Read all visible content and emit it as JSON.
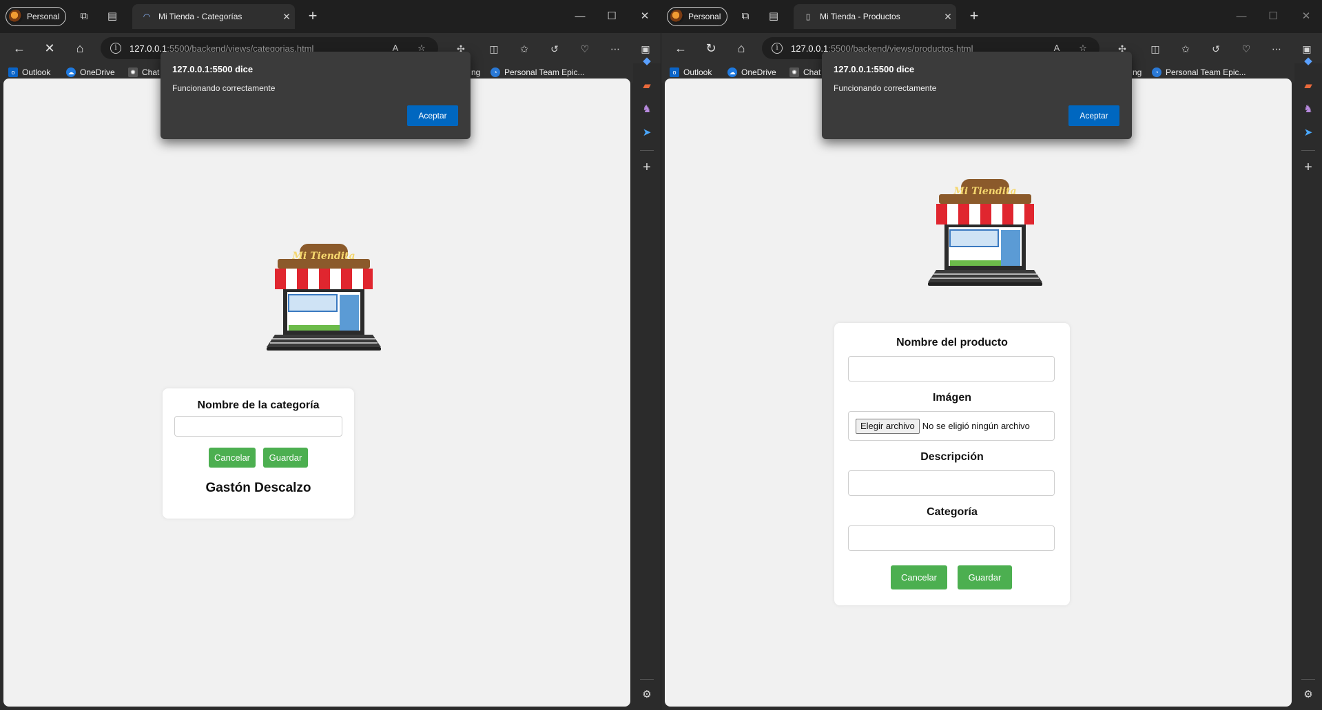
{
  "left": {
    "profile": "Personal",
    "tab_title": "Mi Tienda - Categorías",
    "url_host": "127.0.0.1",
    "url_path": ":5500/backend/views/categorias.html",
    "bookmarks": [
      "Outlook",
      "OneDrive",
      "Chat",
      "ng",
      "Personal Team Epic..."
    ],
    "dialog": {
      "title": "127.0.0.1:5500 dice",
      "message": "Funcionando correctamente",
      "button": "Aceptar"
    },
    "form": {
      "label": "Nombre de la categoría",
      "input_value": "",
      "cancel": "Cancelar",
      "save": "Guardar",
      "author": "Gastón Descalzo"
    }
  },
  "right": {
    "profile": "Personal",
    "tab_title": "Mi Tienda - Productos",
    "url_host": "127.0.0.1",
    "url_path": ":5500/backend/views/productos.html",
    "bookmarks": [
      "Outlook",
      "OneDrive",
      "Chat",
      "ng",
      "Personal Team Epic..."
    ],
    "dialog": {
      "title": "127.0.0.1:5500 dice",
      "message": "Funcionando correctamente",
      "button": "Aceptar"
    },
    "form": {
      "name_label": "Nombre del producto",
      "name_value": "",
      "image_label": "Imágen",
      "file_button": "Elegir archivo",
      "file_status": "No se eligió ningún archivo",
      "desc_label": "Descripción",
      "desc_value": "",
      "cat_label": "Categoría",
      "cat_value": "",
      "cancel": "Cancelar",
      "save": "Guardar"
    }
  },
  "logo_text": "Mi Tiendita",
  "colors": {
    "accent_green": "#4caf50",
    "dialog_button": "#0067c0",
    "awning_red": "#e0262f",
    "awning_brown": "#8b5a2b"
  },
  "icons": [
    "back-icon",
    "stop-icon",
    "reload-icon",
    "home-icon",
    "info-icon",
    "read-aloud-icon",
    "favorite-icon",
    "extensions-icon",
    "split-screen-icon",
    "favorites-icon",
    "history-icon",
    "browser-essentials-icon",
    "more-icon",
    "sidebar-toggle-icon",
    "close-icon",
    "minimize-icon",
    "maximize-icon",
    "plus-icon",
    "settings-icon"
  ]
}
